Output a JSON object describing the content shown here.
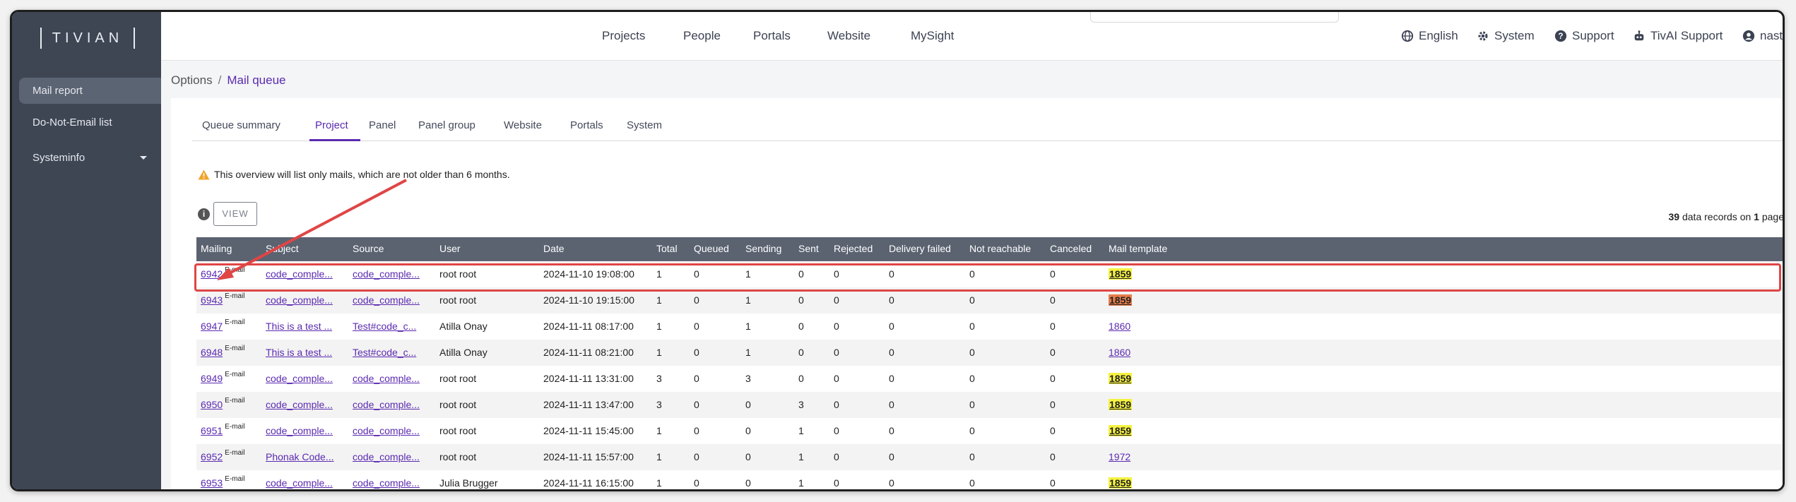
{
  "app": {
    "logo": "TIVIAN"
  },
  "sidebar": {
    "items": [
      {
        "label": "Mail report"
      },
      {
        "label": "Do-Not-Email list"
      },
      {
        "label": "Systeminfo"
      }
    ]
  },
  "topnav": {
    "links": [
      "Projects",
      "People",
      "Portals",
      "Website",
      "MySight"
    ],
    "language": "English",
    "system": "System",
    "support": "Support",
    "tivai": "TivAI Support",
    "user": "nastase"
  },
  "breadcrumb": {
    "parent": "Options",
    "separator": "/",
    "current": "Mail queue"
  },
  "tabs": [
    "Queue summary",
    "Project",
    "Panel",
    "Panel group",
    "Website",
    "Portals",
    "System"
  ],
  "active_tab": "Project",
  "notice": "This overview will list only mails, which are not older than 6 months.",
  "view_button": "VIEW",
  "records": {
    "count": "39",
    "middle": " data records on ",
    "pages": "1",
    "suffix": " pages"
  },
  "table": {
    "headers": [
      "Mailing",
      "Subject",
      "Source",
      "User",
      "Date",
      "Total",
      "Queued",
      "Sending",
      "Sent",
      "Rejected",
      "Delivery failed",
      "Not reachable",
      "Canceled",
      "Mail template"
    ],
    "rows": [
      {
        "mailing": "6942",
        "type": "E-mail",
        "subject": "code_comple...",
        "source": "code_comple...",
        "user": "root root",
        "date": "2024-11-10 19:08:00",
        "total": "1",
        "queued": "0",
        "sending": "1",
        "sent": "0",
        "rejected": "0",
        "failed": "0",
        "unreachable": "0",
        "canceled": "0",
        "template": "1859",
        "template_style": "yellow"
      },
      {
        "mailing": "6943",
        "type": "E-mail",
        "subject": "code_comple...",
        "source": "code_comple...",
        "user": "root root",
        "date": "2024-11-10 19:15:00",
        "total": "1",
        "queued": "0",
        "sending": "1",
        "sent": "0",
        "rejected": "0",
        "failed": "0",
        "unreachable": "0",
        "canceled": "0",
        "template": "1859",
        "template_style": "orange"
      },
      {
        "mailing": "6947",
        "type": "E-mail",
        "subject": "This is a test ...",
        "source": "Test#code_c...",
        "user": "Atilla Onay",
        "date": "2024-11-11 08:17:00",
        "total": "1",
        "queued": "0",
        "sending": "1",
        "sent": "0",
        "rejected": "0",
        "failed": "0",
        "unreachable": "0",
        "canceled": "0",
        "template": "1860",
        "template_style": "link"
      },
      {
        "mailing": "6948",
        "type": "E-mail",
        "subject": "This is a test ...",
        "source": "Test#code_c...",
        "user": "Atilla Onay",
        "date": "2024-11-11 08:21:00",
        "total": "1",
        "queued": "0",
        "sending": "1",
        "sent": "0",
        "rejected": "0",
        "failed": "0",
        "unreachable": "0",
        "canceled": "0",
        "template": "1860",
        "template_style": "link"
      },
      {
        "mailing": "6949",
        "type": "E-mail",
        "subject": "code_comple...",
        "source": "code_comple...",
        "user": "root root",
        "date": "2024-11-11 13:31:00",
        "total": "3",
        "queued": "0",
        "sending": "3",
        "sent": "0",
        "rejected": "0",
        "failed": "0",
        "unreachable": "0",
        "canceled": "0",
        "template": "1859",
        "template_style": "yellow"
      },
      {
        "mailing": "6950",
        "type": "E-mail",
        "subject": "code_comple...",
        "source": "code_comple...",
        "user": "root root",
        "date": "2024-11-11 13:47:00",
        "total": "3",
        "queued": "0",
        "sending": "0",
        "sent": "3",
        "rejected": "0",
        "failed": "0",
        "unreachable": "0",
        "canceled": "0",
        "template": "1859",
        "template_style": "yellow"
      },
      {
        "mailing": "6951",
        "type": "E-mail",
        "subject": "code_comple...",
        "source": "code_comple...",
        "user": "root root",
        "date": "2024-11-11 15:45:00",
        "total": "1",
        "queued": "0",
        "sending": "0",
        "sent": "1",
        "rejected": "0",
        "failed": "0",
        "unreachable": "0",
        "canceled": "0",
        "template": "1859",
        "template_style": "yellow"
      },
      {
        "mailing": "6952",
        "type": "E-mail",
        "subject": "Phonak Code...",
        "source": "code_comple...",
        "user": "root root",
        "date": "2024-11-11 15:57:00",
        "total": "1",
        "queued": "0",
        "sending": "0",
        "sent": "1",
        "rejected": "0",
        "failed": "0",
        "unreachable": "0",
        "canceled": "0",
        "template": "1972",
        "template_style": "link"
      },
      {
        "mailing": "6953",
        "type": "E-mail",
        "subject": "code_comple...",
        "source": "code_comple...",
        "user": "Julia Brugger",
        "date": "2024-11-11 16:15:00",
        "total": "1",
        "queued": "0",
        "sending": "0",
        "sent": "1",
        "rejected": "0",
        "failed": "0",
        "unreachable": "0",
        "canceled": "0",
        "template": "1859",
        "template_style": "yellow"
      }
    ]
  },
  "colors": {
    "sidebar_bg": "#3e4654",
    "accent": "#5b2ab0",
    "table_header_bg": "#5b6371",
    "annotation": "#e04545",
    "template_highlight": "#f5f241",
    "template_highlight_alt": "#e67d4a"
  }
}
